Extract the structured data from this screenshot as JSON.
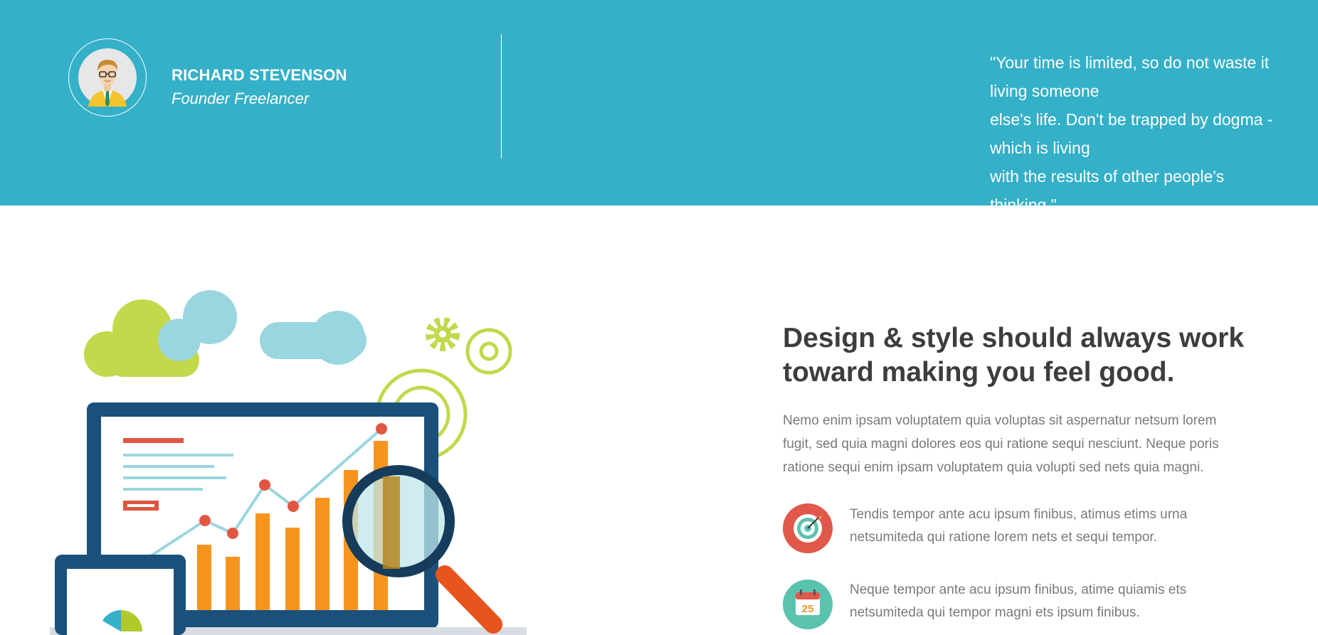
{
  "profile": {
    "name": "RICHARD STEVENSON",
    "role": "Founder Freelancer"
  },
  "quote": {
    "lines": [
      "\"Your time is limited, so do not waste it",
      "living someone",
      "else's life. Don't be trapped by dogma -",
      "which is living",
      "with the results of other people's",
      "thinking.\""
    ]
  },
  "feature": {
    "heading_lines": [
      "Design & style should always work",
      "toward making you feel good."
    ],
    "paragraph_lines": [
      "Nemo enim ipsam voluptatem quia voluptas sit aspernatur netsum lorem",
      "fugit, sed quia magni dolores eos qui ratione sequi nesciunt. Neque poris",
      "ratione sequi enim ipsam voluptatem quia volupti sed nets quia magni."
    ],
    "items": [
      {
        "icon": "target-icon",
        "color": "#e0584a",
        "lines": [
          "Tendis tempor ante acu ipsum finibus, atimus etims urna",
          "netsumiteda qui ratione lorem nets et sequi tempor."
        ]
      },
      {
        "icon": "calendar-icon",
        "calendar_day": "25",
        "color": "#5cc2b0",
        "lines": [
          "Neque tempor ante acu ipsum finibus, atime quiamis ets",
          "netsumiteda qui tempor magni ets ipsum finibus."
        ]
      }
    ]
  },
  "colors": {
    "banner": "#34b0c8",
    "heading": "#3d3d3d",
    "body_text": "#7a7a7a"
  }
}
